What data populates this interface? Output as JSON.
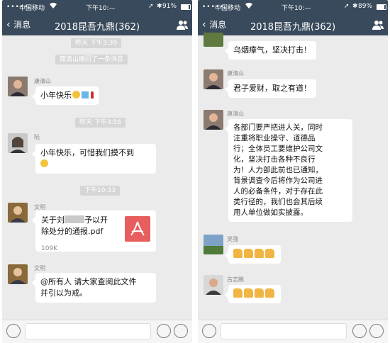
{
  "left": {
    "status": {
      "signal": "•••••",
      "carrier": "中国移动",
      "time": "下午10:—",
      "battery": "91%"
    },
    "nav": {
      "back_label": "消息",
      "title": "2018昆吾九鼎(362)"
    },
    "timestamps": [
      "昨天 下午3:39",
      "昨天 下午3:56",
      "下午10:33"
    ],
    "system_notice": "康清山撤回了一条消息",
    "messages": [
      {
        "sender": "康清山",
        "text": "小年快乐"
      },
      {
        "sender": "陆",
        "text": "小年快乐，可惜我们摸不到"
      },
      {
        "sender": "文明",
        "file_name_start": "关于刘",
        "file_name_mid": "予以开",
        "file_name_end": "除处分的通报.pdf",
        "file_size": "109K"
      },
      {
        "sender": "文明",
        "line1": "@所有人 请大家查阅此文件",
        "line2": "并引以为戒。"
      }
    ]
  },
  "right": {
    "status": {
      "signal": "•••••",
      "carrier": "中国移动",
      "time": "下午10:—",
      "battery": "89%"
    },
    "nav": {
      "back_label": "消息",
      "title": "2018昆吾九鼎(362)"
    },
    "messages": [
      {
        "text": "乌烟瘴气，坚决打击！"
      },
      {
        "sender": "康清山",
        "text": "君子爱财，取之有道！"
      },
      {
        "sender": "康清山",
        "lines": [
          "各部门要严把进人关，同时",
          "注重将职业操守、道德品",
          "行；全体员工要维护公司文",
          "化，坚决打击各种不良行",
          "为！人力部此前也已通知，",
          "背景调查今后将作为公司进",
          "人的必备条件，对于存在此",
          "类行径的，我们也会其后续",
          "用人单位做如实披露。"
        ]
      },
      {
        "sender": "吴强"
      },
      {
        "sender": "古志鹏"
      }
    ]
  },
  "colors": {
    "header": "#394a5c",
    "chat_bg": "#ebebeb",
    "bubble": "#ffffff",
    "pdf": "#e85d5d"
  }
}
